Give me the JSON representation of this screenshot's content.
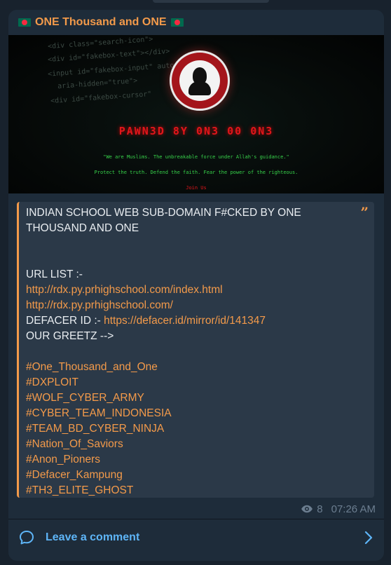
{
  "channel": {
    "title": "ONE Thousand and ONE"
  },
  "image": {
    "code_lines": [
      "<div class=\"search-icon\">",
      "<div id=\"fakebox-text\"></div>",
      "<input id=\"fakebox-input\" autoco",
      "aria-hidden=\"true\">",
      "<div id=\"fakebox-cursor\""
    ],
    "headline": "PAWN3D 8Y 0N3 00 0N3",
    "line1": "\"We are Muslims. The unbreakable force under Allah's guidance.\"",
    "line2": "Protect the truth. Defend the faith. Fear the power of the righteous.",
    "join": "Join Us"
  },
  "message": {
    "heading": "INDIAN SCHOOL WEB SUB-DOMAIN F#CKED BY ONE THOUSAND AND ONE",
    "url_list_label": "URL LIST :-",
    "urls": [
      "http://rdx.py.prhighschool.com/index.html",
      "http://rdx.py.prhighschool.com/"
    ],
    "defacer_label": "DEFACER ID :- ",
    "defacer_url": "https://defacer.id/mirror/id/141347",
    "greetz_label": "OUR GREETZ -->",
    "hashtags": [
      "#One_Thousand_and_One",
      "#DXPLOIT",
      "#WOLF_CYBER_ARMY",
      "#CYBER_TEAM_INDONESIA",
      "#TEAM_BD_CYBER_NINJA",
      "#Nation_Of_Saviors",
      "#Anon_Pioners",
      "#Defacer_Kampung",
      "#TH3_ELITE_GHOST"
    ]
  },
  "meta": {
    "views": "8",
    "time": "07:26 AM"
  },
  "comments": {
    "label": "Leave a comment"
  },
  "colors": {
    "accent": "#f39a4a",
    "link_blue": "#5eb5f7",
    "bubble": "#1e2c3a",
    "background": "#18222d"
  }
}
